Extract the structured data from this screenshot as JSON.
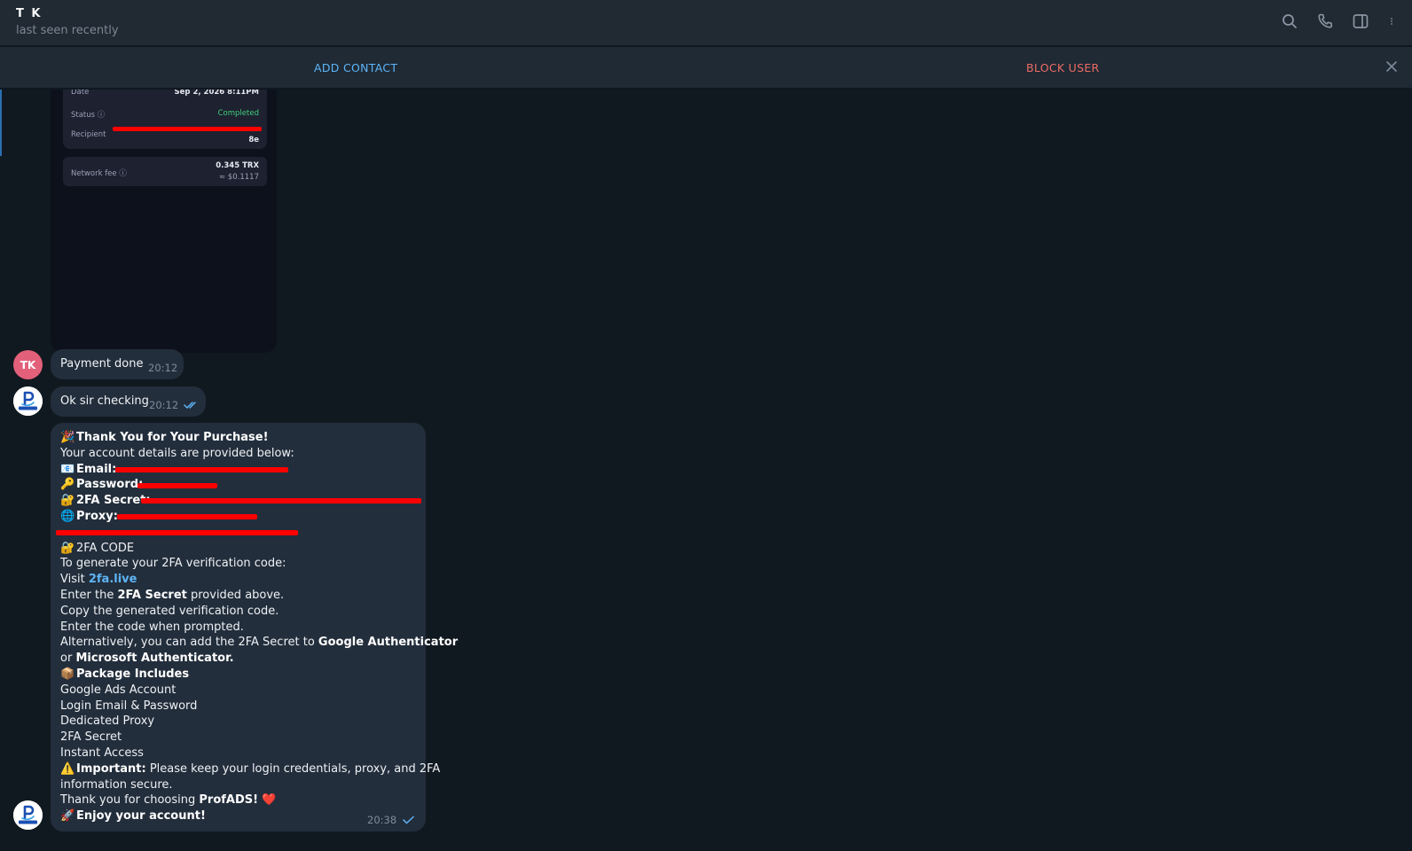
{
  "header": {
    "name": "T K",
    "status": "last seen recently",
    "icons": [
      "search-icon",
      "phone-icon",
      "sidebar-toggle-icon",
      "more-vertical-icon"
    ]
  },
  "action_bar": {
    "add_contact": "ADD CONTACT",
    "block_user": "BLOCK USER"
  },
  "receipt": {
    "date_label": "Date",
    "date_value": "Sep 2, 2026 8:11PM",
    "status_label": "Status",
    "status_value": "Completed",
    "recipient_label": "Recipient",
    "recipient_tail": "8e",
    "fee_label": "Network fee",
    "fee_value": "0.345 TRX",
    "fee_usd": "≈ $0.1117"
  },
  "messages": {
    "payment": {
      "avatar": "TK",
      "text": "Payment done",
      "time": "20:12"
    },
    "checking": {
      "text": "Ok sir checking",
      "time": "20:12"
    },
    "purchase": {
      "time": "20:38",
      "title": "Thank You for Your Purchase!",
      "intro": "Your account details are provided below:",
      "email_label": "Email:",
      "password_label": "Password:",
      "secret_label": "2FA Secret:",
      "proxy_label": "Proxy:",
      "code_heading": "2FA CODE",
      "code_intro": "To generate your 2FA verification code:",
      "visit": "Visit ",
      "visit_link": "2fa.live",
      "enter_pre": "Enter the ",
      "enter_bold": "2FA Secret",
      "enter_post": " provided above.",
      "copy_line": "Copy the generated verification code.",
      "prompt_line": "Enter the code when prompted.",
      "alt_pre": "Alternatively, you can add the 2FA Secret to ",
      "alt_bold": "Google Authenticator",
      "or_pre": "or ",
      "or_bold": "Microsoft Authenticator.",
      "package_heading": "Package Includes",
      "package_items": [
        "Google Ads Account",
        "Login Email & Password",
        "Dedicated Proxy",
        "2FA Secret",
        "Instant Access"
      ],
      "important_bold": "Important:",
      "important_text": " Please keep your login credentials, proxy, and 2FA",
      "important_text2": "information secure.",
      "thanks_pre": "Thank you for choosing ",
      "thanks_bold": "ProfADS!",
      "enjoy": "Enjoy your account!"
    }
  },
  "colors": {
    "background": "#111920",
    "bubble": "#232e3c",
    "header": "#212a33",
    "accent_blue": "#5eb5f7",
    "block_red": "#ec6c62",
    "redaction": "#ff0000"
  }
}
